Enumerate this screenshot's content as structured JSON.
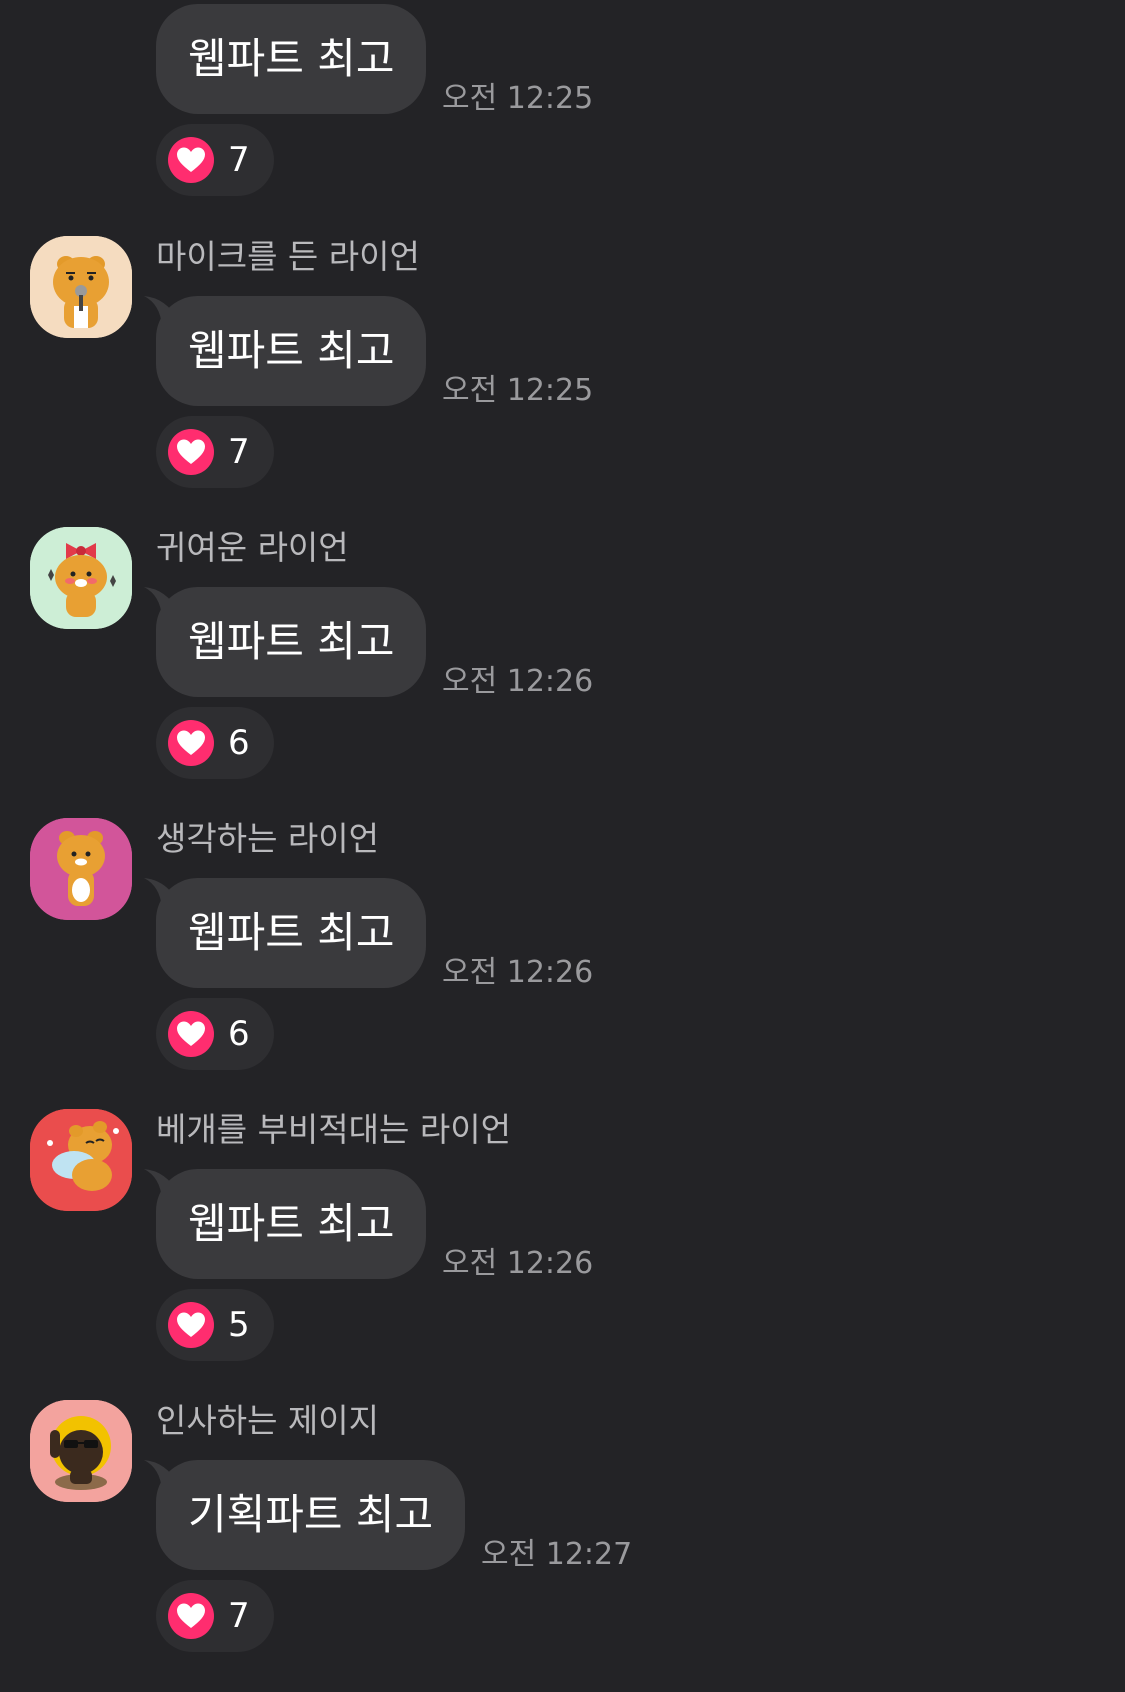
{
  "messages": [
    {
      "sender": "",
      "text": "웹파트 최고",
      "time": "오전 12:25",
      "reaction_count": "7",
      "avatar": null
    },
    {
      "sender": "마이크를 든 라이언",
      "text": "웹파트 최고",
      "time": "오전 12:25",
      "reaction_count": "7",
      "avatar": {
        "icon": "ryan-microphone-avatar-icon",
        "bg": "#f5dcc0"
      }
    },
    {
      "sender": "귀여운 라이언",
      "text": "웹파트 최고",
      "time": "오전 12:26",
      "reaction_count": "6",
      "avatar": {
        "icon": "ryan-cute-ribbon-avatar-icon",
        "bg": "#cdeed6"
      }
    },
    {
      "sender": "생각하는 라이언",
      "text": "웹파트 최고",
      "time": "오전 12:26",
      "reaction_count": "6",
      "avatar": {
        "icon": "ryan-thinking-avatar-icon",
        "bg": "#d2559a"
      }
    },
    {
      "sender": "베개를 부비적대는 라이언",
      "text": "웹파트 최고",
      "time": "오전 12:26",
      "reaction_count": "5",
      "avatar": {
        "icon": "ryan-pillow-avatar-icon",
        "bg": "#ea4d4d"
      }
    },
    {
      "sender": "인사하는 제이지",
      "text": "기획파트 최고",
      "time": "오전 12:27",
      "reaction_count": "7",
      "avatar": {
        "icon": "jayg-greeting-avatar-icon",
        "bg": "#f3a39e"
      }
    }
  ],
  "colors": {
    "background": "#232326",
    "bubble": "#3a3a3d",
    "heart": "#ff2d6f"
  },
  "reaction_icon": "heart-icon"
}
